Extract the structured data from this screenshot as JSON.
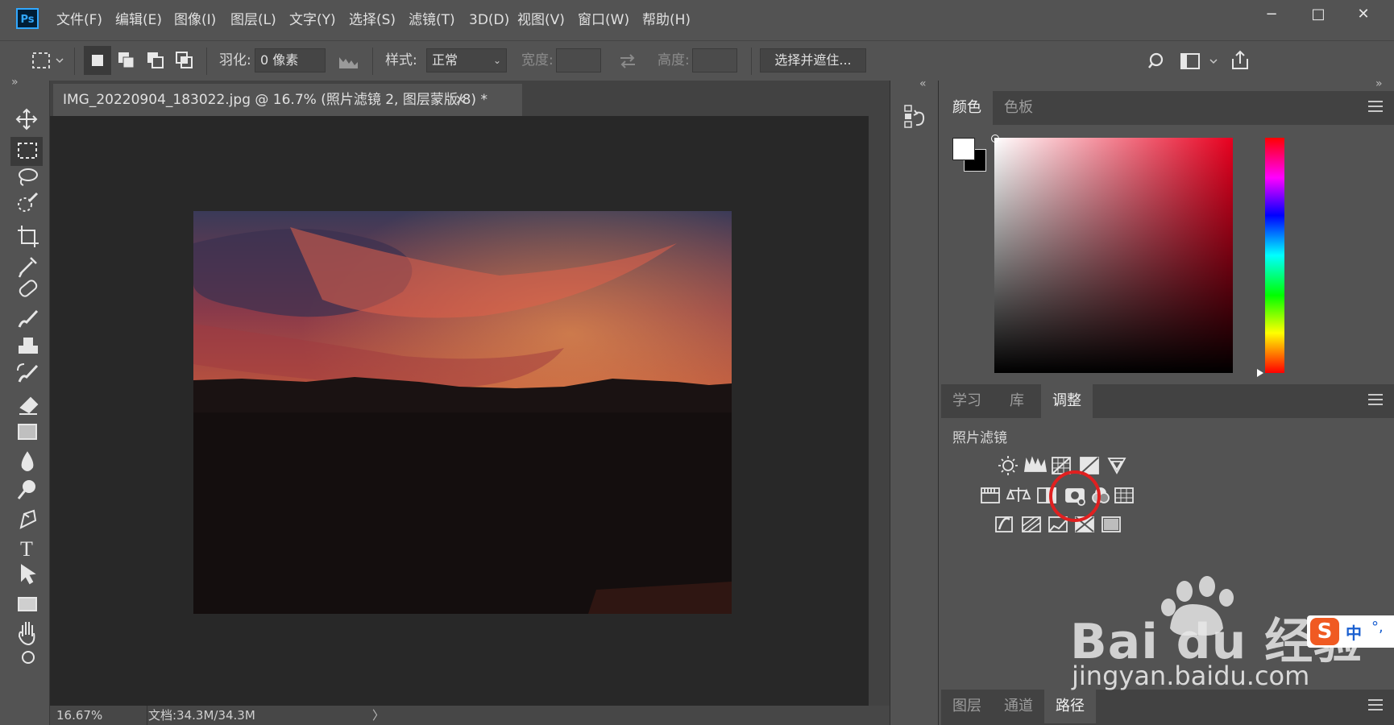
{
  "app": {
    "logo": "Ps"
  },
  "menu": [
    "文件(F)",
    "编辑(E)",
    "图像(I)",
    "图层(L)",
    "文字(Y)",
    "选择(S)",
    "滤镜(T)",
    "3D(D)",
    "视图(V)",
    "窗口(W)",
    "帮助(H)"
  ],
  "window_controls": {
    "minimize": "−",
    "restore": "□",
    "close": "✕"
  },
  "options": {
    "feather_label": "羽化:",
    "feather_value": "0 像素",
    "style_label": "样式:",
    "style_value": "正常",
    "width_label": "宽度:",
    "height_label": "高度:",
    "select_mask": "选择并遮住..."
  },
  "document": {
    "tab_title": "IMG_20220904_183022.jpg @ 16.7% (照片滤镜 2, 图层蒙版/8) *",
    "close": "×",
    "zoom": "16.67%",
    "doc_size": "文档:34.3M/34.3M"
  },
  "panel_collapse": {
    "left": "»",
    "mid": "«",
    "right": "»"
  },
  "color_panel": {
    "tabs": [
      "颜色",
      "色板"
    ],
    "active_tab": "颜色",
    "foreground": "#ffffff",
    "background": "#000000",
    "hue_color": "#e8001f"
  },
  "adjust_panel": {
    "tabs": [
      "学习",
      "库",
      "调整"
    ],
    "active_tab": "调整",
    "current_adjustment": "照片滤镜",
    "highlight_color": "#e02020"
  },
  "layers_panel": {
    "tabs": [
      "图层",
      "通道",
      "路径"
    ],
    "active_tab": "路径"
  },
  "watermark": {
    "brand": "Bai du 经验",
    "url": "jingyan.baidu.com"
  },
  "ime": {
    "label": "中",
    "dots": "°,"
  }
}
